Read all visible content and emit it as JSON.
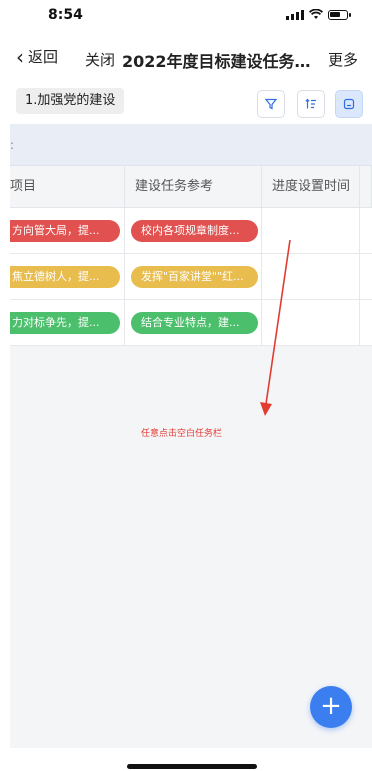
{
  "status_bar": {
    "time": "8:54"
  },
  "nav": {
    "back_label": "返回",
    "close_label": "关闭",
    "title": "2022年度目标建设任务...",
    "more_label": "更多"
  },
  "toolbar": {
    "tab_label": "1.加强党的建设",
    "icons": [
      "filter-icon",
      "sort-icon",
      "view-icon"
    ]
  },
  "table": {
    "group_label": ":",
    "columns": [
      "项目",
      "建设任务参考",
      "进度设置时间"
    ],
    "rows": [
      {
        "col1": "方向管大局，提...",
        "col2": "校内各项规章制度...",
        "color": "#e0514f"
      },
      {
        "col1": "焦立德树人，提...",
        "col2": "发挥\"百家讲堂\"\"红...",
        "color": "#e8bd4e"
      },
      {
        "col1": "力对标争先，提...",
        "col2": "结合专业特点，建...",
        "color": "#4bbf6b"
      }
    ]
  },
  "annotation": {
    "text": "任意点击空白任务栏"
  },
  "fab": {
    "label": "+"
  }
}
